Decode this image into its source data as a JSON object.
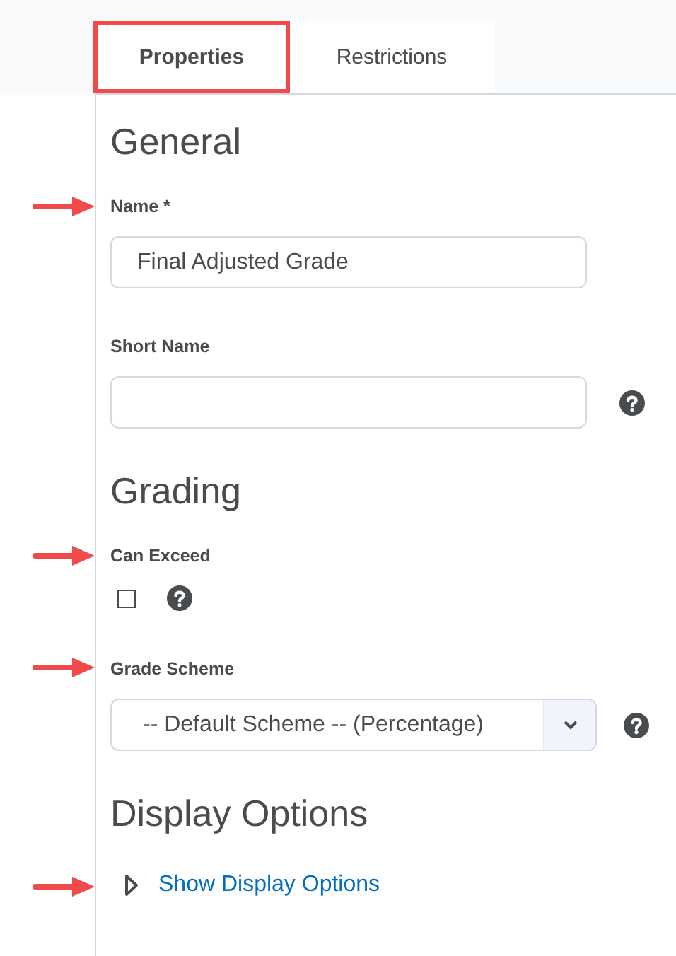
{
  "tabs": [
    {
      "label": "Properties",
      "selected": true,
      "highlighted": true
    },
    {
      "label": "Restrictions",
      "selected": false,
      "highlighted": false
    }
  ],
  "sections": [
    {
      "heading": "General",
      "fields": [
        {
          "kind": "text",
          "label": "Name *",
          "value": "Final Adjusted Grade",
          "help": false,
          "marked": true
        },
        {
          "kind": "text",
          "label": "Short Name",
          "help": true,
          "marked": false
        }
      ]
    },
    {
      "heading": "Grading",
      "fields": [
        {
          "kind": "checkbox",
          "label": "Can Exceed",
          "checked": false,
          "help": true,
          "marked": true
        },
        {
          "kind": "select",
          "label": "Grade Scheme",
          "value": "-- Default Scheme -- (Percentage)",
          "help": true,
          "marked": true
        }
      ]
    },
    {
      "heading": "Display Options",
      "fields": [
        {
          "kind": "disclosure",
          "link": "Show Display Options",
          "expanded": false,
          "help": false,
          "marked": true
        }
      ]
    }
  ]
}
